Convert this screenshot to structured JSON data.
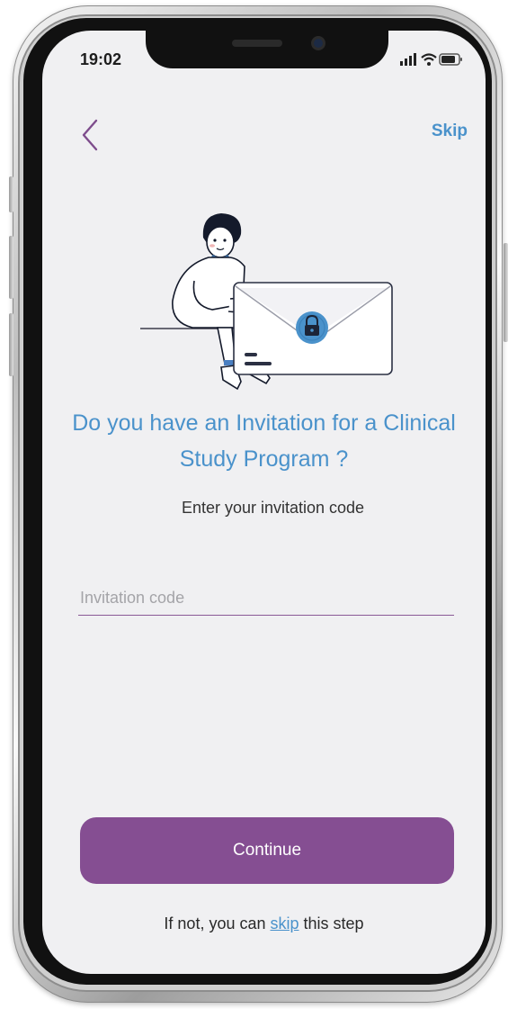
{
  "status_bar": {
    "time": "19:02",
    "signal_icon": "cellular-signal-icon",
    "wifi_icon": "wifi-icon",
    "battery_icon": "battery-icon"
  },
  "nav": {
    "back_icon": "chevron-left-icon",
    "skip_label": "Skip"
  },
  "illustration": {
    "name": "person-with-locked-envelope-illustration",
    "lock_icon": "padlock-icon"
  },
  "main": {
    "title": "Do you have an Invitation for a Clinical Study Program ?",
    "subtitle": "Enter your invitation code",
    "invitation_input": {
      "value": "",
      "placeholder": "Invitation code"
    },
    "continue_label": "Continue"
  },
  "footer": {
    "prefix": "If not, you can ",
    "link": "skip",
    "suffix": " this step"
  },
  "colors": {
    "accent_blue": "#4a92cb",
    "primary_purple": "#854e92",
    "background": "#f0f0f2"
  }
}
